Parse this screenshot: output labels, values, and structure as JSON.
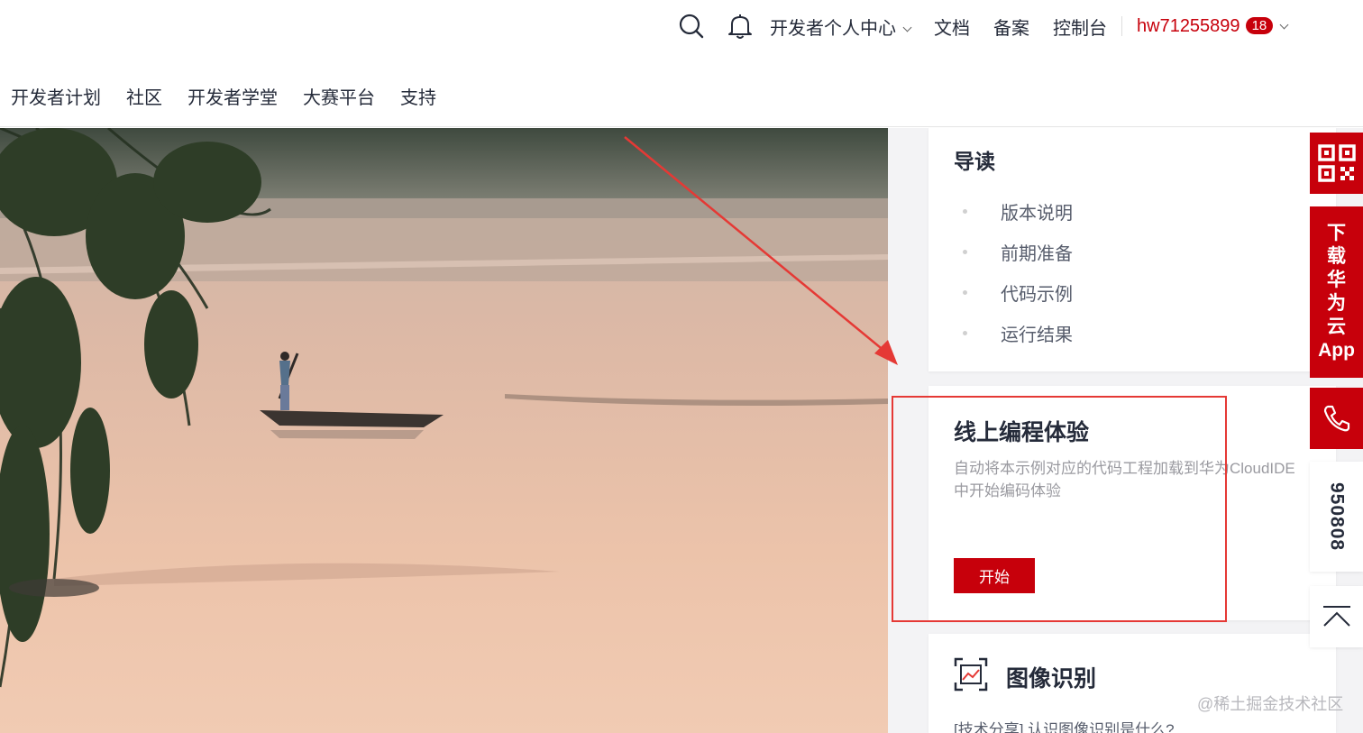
{
  "header": {
    "nav": [
      "开发者个人中心",
      "文档",
      "备案",
      "控制台"
    ],
    "username": "hw71255899",
    "badge_count": "18",
    "sub_nav": [
      "开发者计划",
      "社区",
      "开发者学堂",
      "大赛平台",
      "支持"
    ]
  },
  "toc": {
    "title": "导读",
    "items": [
      "版本说明",
      "前期准备",
      "代码示例",
      "运行结果"
    ]
  },
  "online_ide": {
    "title": "线上编程体验",
    "description": "自动将本示例对应的代码工程加载到华为CloudIDE中开始编码体验",
    "button": "开始"
  },
  "image_recog": {
    "title": "图像识别",
    "article": "[技术分享] 认识图像识别是什么?"
  },
  "float_bar": {
    "app_text": [
      "下",
      "载",
      "华",
      "为",
      "云",
      "App"
    ],
    "phone_number": "950808"
  },
  "watermark": "@稀土掘金技术社区",
  "colors": {
    "brand_red": "#c7000b",
    "annotation_red": "#e53935"
  }
}
